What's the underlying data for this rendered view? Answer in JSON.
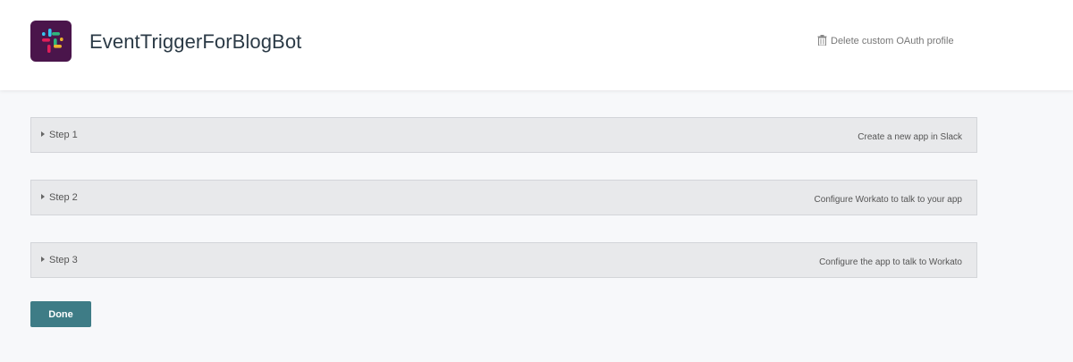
{
  "header": {
    "app_title": "EventTriggerForBlogBot",
    "app_icon": "slack-logo-icon",
    "delete_label": "Delete custom OAuth profile",
    "delete_icon": "trash-icon"
  },
  "steps": [
    {
      "label": "Step 1",
      "description": "Create a new app in Slack"
    },
    {
      "label": "Step 2",
      "description": "Configure Workato to talk to your app"
    },
    {
      "label": "Step 3",
      "description": "Configure the app to talk to Workato"
    }
  ],
  "done_label": "Done",
  "colors": {
    "header_bg": "#ffffff",
    "page_bg": "#f7f8fa",
    "step_bg": "#e8e9eb",
    "done_button": "#3e7c86",
    "logo_bg": "#4a154b"
  }
}
